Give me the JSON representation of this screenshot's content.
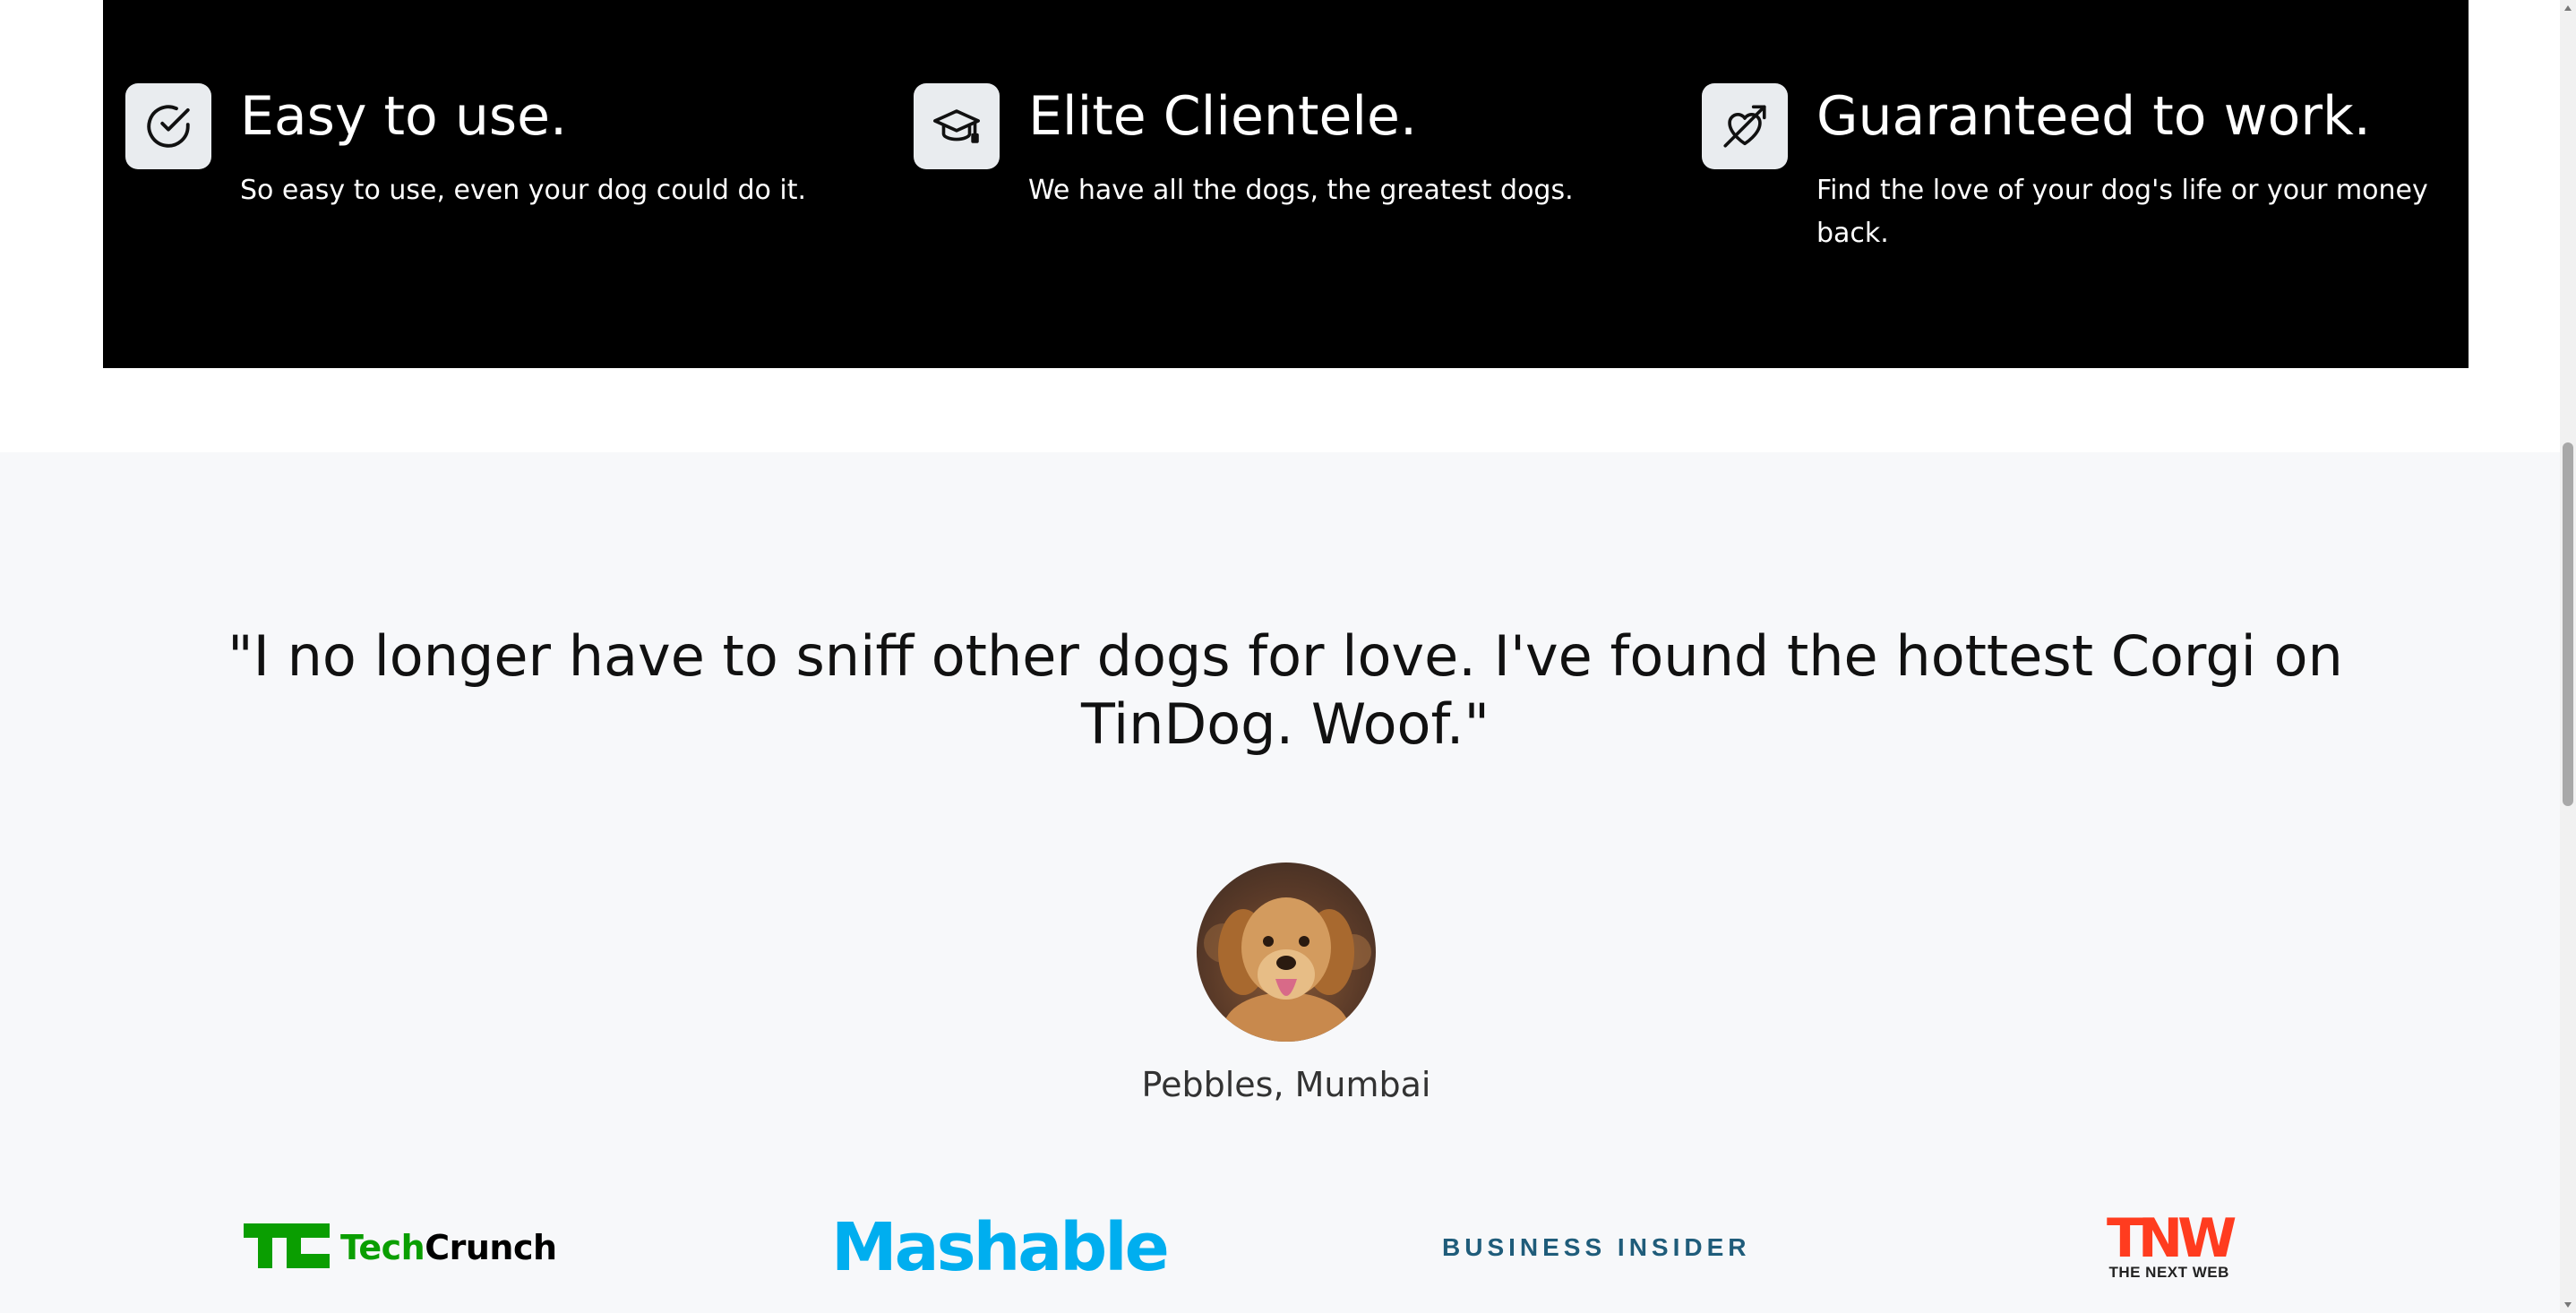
{
  "features": [
    {
      "icon": "check-circle-icon",
      "title": "Easy to use.",
      "description": "So easy to use, even your dog could do it."
    },
    {
      "icon": "graduation-cap-icon",
      "title": "Elite Clientele.",
      "description": "We have all the dogs, the greatest dogs."
    },
    {
      "icon": "heart-arrow-icon",
      "title": "Guaranteed to work.",
      "description": "Find the love of your dog's life or your money back."
    }
  ],
  "testimonial": {
    "quote": "\"I no longer have to sniff other dogs for love. I've found the hottest Corgi on TinDog. Woof.\"",
    "avatar_icon": "dog-avatar",
    "author": "Pebbles, Mumbai"
  },
  "press": {
    "techcrunch": {
      "part1": "Tech",
      "part2": "Crunch"
    },
    "mashable": "Mashable",
    "business_insider": "BUSINESS INSIDER",
    "tnw": {
      "big": "TNW",
      "small": "THE NEXT WEB"
    }
  },
  "colors": {
    "feature_band": "#000000",
    "testimonial_bg": "#f7f8fa",
    "techcrunch_green": "#0a9e01",
    "mashable_blue": "#00aeef",
    "business_insider_blue": "#1f5c7a",
    "tnw_red": "#ff3c1f"
  }
}
